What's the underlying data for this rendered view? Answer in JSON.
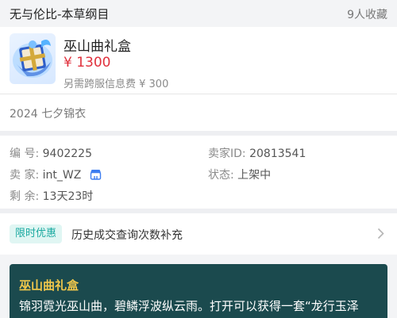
{
  "header": {
    "title": "无与伦比-本草纲目",
    "favorites": "9人收藏"
  },
  "item": {
    "name": "巫山曲礼盒",
    "price": "¥ 1300",
    "fee": "另需跨服信息费 ¥ 300",
    "icon": "gift-box-icon"
  },
  "outfit": {
    "label": "2024 七夕锦衣"
  },
  "info": {
    "id_label": "编  号:",
    "id_value": "9402225",
    "seller_id_label": "卖家ID:",
    "seller_id_value": "20813541",
    "seller_label": "卖  家:",
    "seller_value": "int_WZ",
    "status_label": "状态:",
    "status_value": "上架中",
    "remaining_label": "剩  余:",
    "remaining_value": "13天23时",
    "shop_icon": "shop-icon"
  },
  "promo": {
    "badge": "限时优惠",
    "text": "历史成交查询次数补充",
    "chevron_icon": "chevron-right-icon"
  },
  "description": {
    "title": "巫山曲礼盒",
    "body": "锦羽霓光巫山曲，碧鳞浮波纵云雨。打开可以获得一套“龙行玉泽"
  },
  "colors": {
    "price": "#e0303c",
    "badge_text": "#1aa9a0",
    "badge_bg": "#e0f6f3",
    "desc_bg": "#1b4a4e",
    "desc_title": "#f2c84b"
  }
}
